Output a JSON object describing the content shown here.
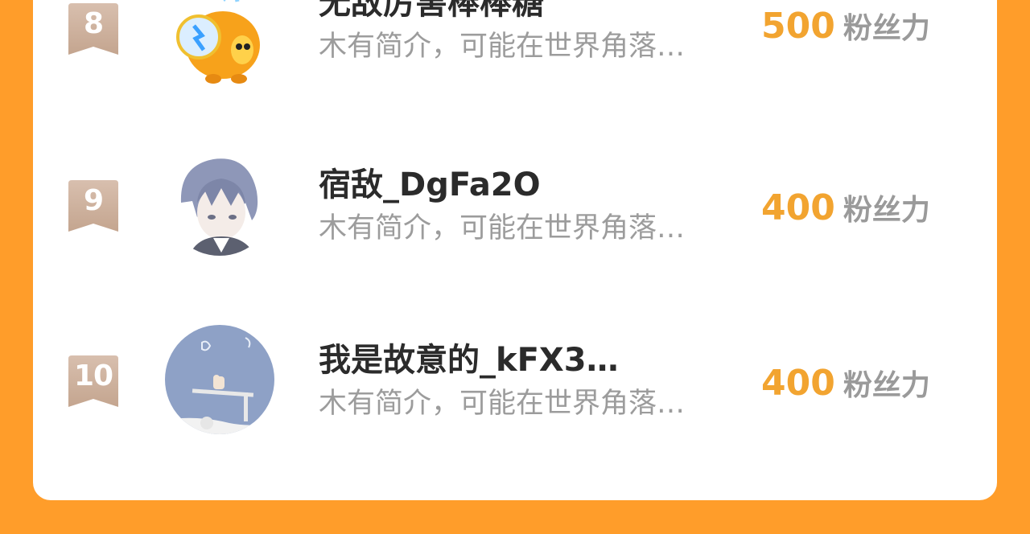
{
  "ranking": {
    "rows": [
      {
        "rank": "8",
        "name": "无敌厉害棒棒糖",
        "bio": "木有简介，可能在世界角落…",
        "score": "500",
        "unit": "粉丝力",
        "avatar_icon": "orange-cartoon-character"
      },
      {
        "rank": "9",
        "name": "宿敌_DgFa2O",
        "bio": "木有简介，可能在世界角落…",
        "score": "400",
        "unit": "粉丝力",
        "avatar_icon": "anime-boy-portrait"
      },
      {
        "rank": "10",
        "name": "我是故意的_kFX3…",
        "bio": "木有简介，可能在世界角落…",
        "score": "400",
        "unit": "粉丝力",
        "avatar_icon": "blue-sky-seesaw-illustration"
      }
    ]
  },
  "colors": {
    "background": "#FF9D2A",
    "score_accent": "#F2A430",
    "rank_badge": "#CBAE98"
  }
}
